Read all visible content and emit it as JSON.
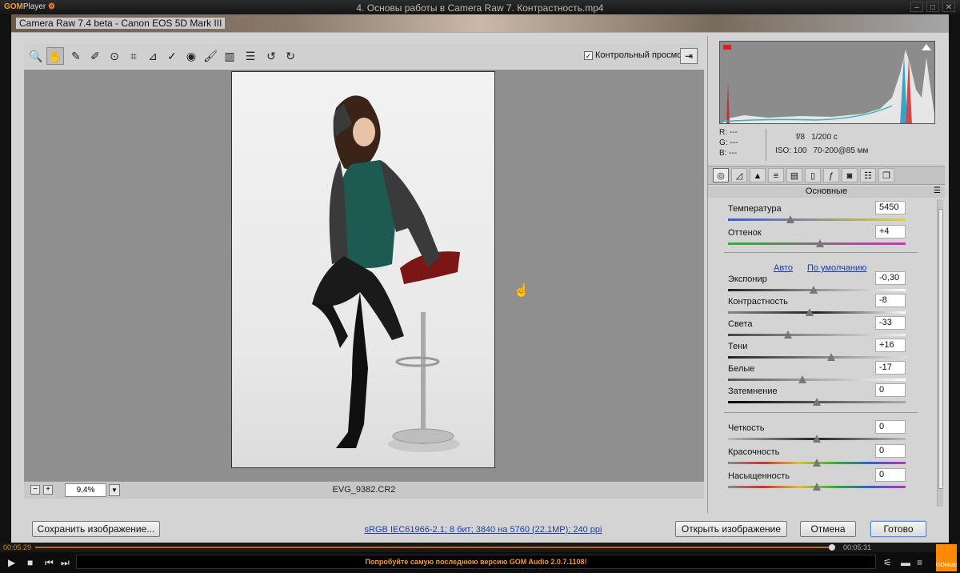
{
  "player": {
    "logo": "GOM",
    "logo_sub": "Player",
    "title": "4. Основы работы в Camera Raw 7. Контрастность.mp4"
  },
  "cr": {
    "window_title": "Camera Raw 7.4 beta  -  Canon EOS 5D Mark III",
    "preview_label": "Контрольный просмотр",
    "zoom": "9,4%",
    "filename": "EVG_9382.CR2",
    "save_btn": "Сохранить изображение...",
    "info_link": "sRGB IEC61966-2.1; 8 бит; 3840 на 5760 (22,1MP); 240 ppi",
    "open_btn": "Открыть изображение",
    "cancel_btn": "Отмена",
    "done_btn": "Готово",
    "rgb": {
      "r": "R:   ---",
      "g": "G:   ---",
      "b": "B:   ---"
    },
    "cam": {
      "aperture": "f/8",
      "shutter": "1/200 с",
      "iso": "ISO: 100",
      "lens": "70-200@85 мм"
    },
    "panel_title": "Основные",
    "auto": "Авто",
    "default": "По умолчанию",
    "sliders": {
      "temp": {
        "label": "Температура",
        "value": "5450",
        "pos": 0.35
      },
      "tint": {
        "label": "Оттенок",
        "value": "+4",
        "pos": 0.52
      },
      "exposure": {
        "label": "Экспониp",
        "value": "-0,30",
        "pos": 0.48
      },
      "contrast": {
        "label": "Контрастность",
        "value": "-8",
        "pos": 0.46
      },
      "highlights": {
        "label": "Света",
        "value": "-33",
        "pos": 0.34
      },
      "shadows": {
        "label": "Тени",
        "value": "+16",
        "pos": 0.58
      },
      "whites": {
        "label": "Белые",
        "value": "-17",
        "pos": 0.42
      },
      "blacks": {
        "label": "Затемнение",
        "value": "0",
        "pos": 0.5
      },
      "clarity": {
        "label": "Четкость",
        "value": "0",
        "pos": 0.5
      },
      "vibrance": {
        "label": "Красочность",
        "value": "0",
        "pos": 0.5
      },
      "saturation": {
        "label": "Насыщенность",
        "value": "0",
        "pos": 0.5
      }
    }
  },
  "gom": {
    "time_current": "00:05:29",
    "time_total": "00:05:31",
    "message": "Попробуйте самую последнюю версию GOM Audio 2.0.7.1108!",
    "lab": "GOMlab"
  },
  "colors": {
    "accent": "#ff9a1e",
    "link": "#1a3ea6"
  }
}
